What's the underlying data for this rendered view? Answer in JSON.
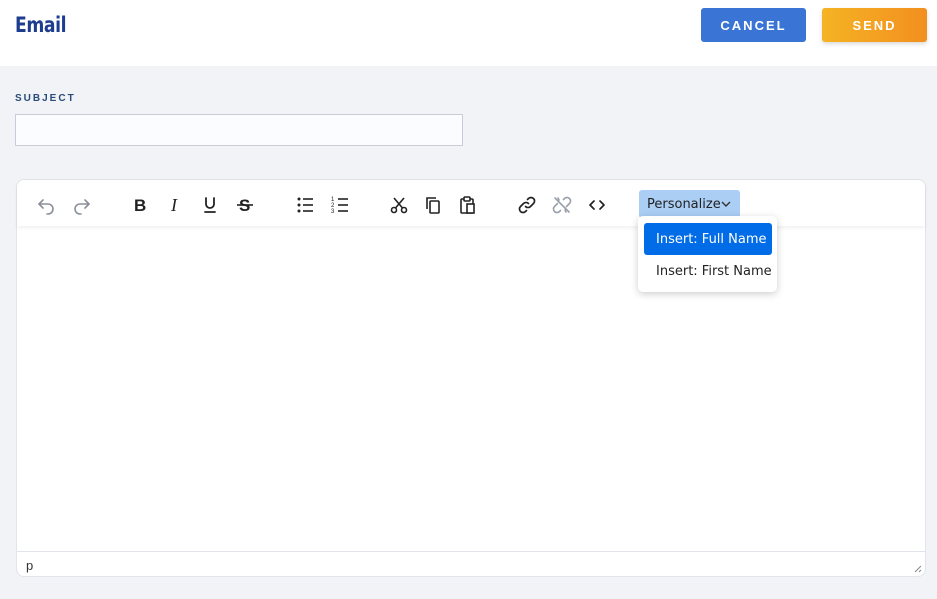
{
  "header": {
    "title": "Email",
    "cancel_label": "CANCEL",
    "send_label": "SEND"
  },
  "subject": {
    "label": "SUBJECT",
    "value": ""
  },
  "toolbar": {
    "buttons": [
      "undo-icon",
      "redo-icon",
      "bold-icon",
      "italic-icon",
      "underline-icon",
      "strikethrough-icon",
      "bullet-list-icon",
      "numbered-list-icon",
      "cut-icon",
      "copy-icon",
      "paste-icon",
      "link-icon",
      "unlink-icon",
      "source-code-icon"
    ],
    "personalize_label": "Personalize"
  },
  "personalize_menu": {
    "items": [
      "Insert: Full Name",
      "Insert: First Name"
    ],
    "active_index": 0
  },
  "statusbar": {
    "path": "p"
  },
  "colors": {
    "title": "#1d3d8f",
    "cancel": "#3a74d4",
    "send_start": "#f5b324",
    "send_end": "#f28f1f",
    "personalize_bg": "#abcef5",
    "menu_active": "#006ce7"
  }
}
